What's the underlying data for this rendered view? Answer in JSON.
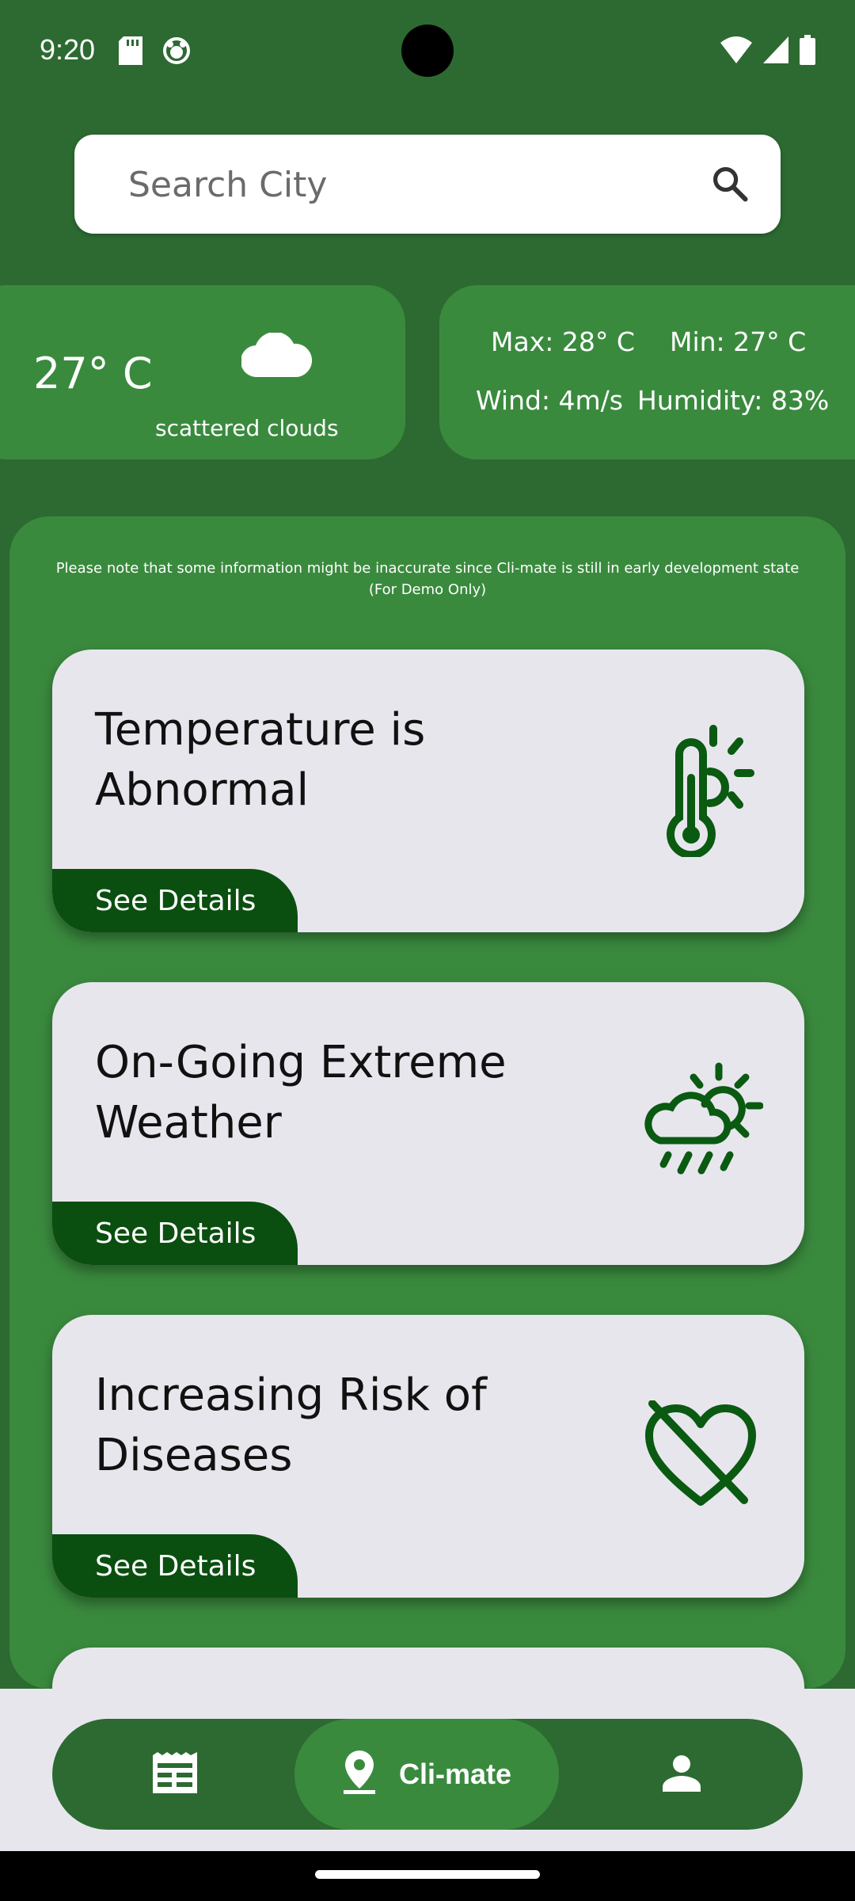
{
  "status_bar": {
    "time": "9:20"
  },
  "search": {
    "placeholder": "Search City"
  },
  "current_weather": {
    "temperature": "27° C",
    "description": "scattered clouds",
    "max": "Max: 28° C",
    "min": "Min: 27° C",
    "wind": "Wind: 4m/s",
    "humidity": "Humidity: 83%"
  },
  "disclaimer": "Please note that some information might be inaccurate since Cli-mate is still in early development state (For Demo Only)",
  "alerts": [
    {
      "title": "Temperature is Abnormal",
      "button": "See Details",
      "icon": "thermometer-sun-icon"
    },
    {
      "title": "On-Going Extreme Weather",
      "button": "See Details",
      "icon": "storm-cloud-sun-icon"
    },
    {
      "title": "Increasing Risk of Diseases",
      "button": "See Details",
      "icon": "heart-off-icon"
    }
  ],
  "nav": {
    "items": [
      {
        "icon": "news-icon"
      },
      {
        "icon": "location-pin-icon",
        "label": "Cli-mate",
        "active": true
      },
      {
        "icon": "person-icon"
      }
    ]
  },
  "colors": {
    "background": "#2c6a31",
    "panel": "#3a8a3e",
    "card": "#e8e6ed",
    "button": "#0a4f0f",
    "icon": "#0a5a12"
  }
}
